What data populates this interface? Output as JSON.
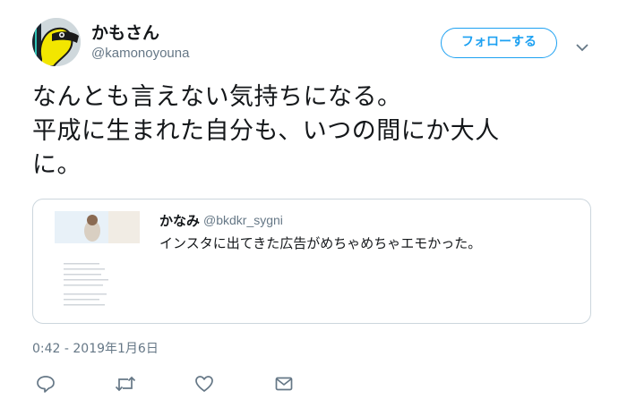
{
  "author": {
    "name": "かもさん",
    "handle": "@kamonoyouna"
  },
  "follow_label": "フォローする",
  "tweet_text": "なんとも言えない気持ちになる。\n平成に生まれた自分も、いつの間にか大人\nに。",
  "quoted_tweet": {
    "name": "かなみ",
    "handle": "@bkdkr_sygni",
    "text": "インスタに出てきた広告がめちゃめちゃエモかった。"
  },
  "timestamp": "0:42 - 2019年1月6日",
  "actions": {
    "reply_icon": "speech-bubble-icon",
    "retweet_icon": "retweet-arrows-icon",
    "like_icon": "heart-icon",
    "dm_icon": "envelope-icon"
  },
  "colors": {
    "accent": "#1da1f2",
    "text": "#14171a",
    "secondary_text": "#657786",
    "border": "#ccd6dd",
    "icon": "#657786"
  }
}
